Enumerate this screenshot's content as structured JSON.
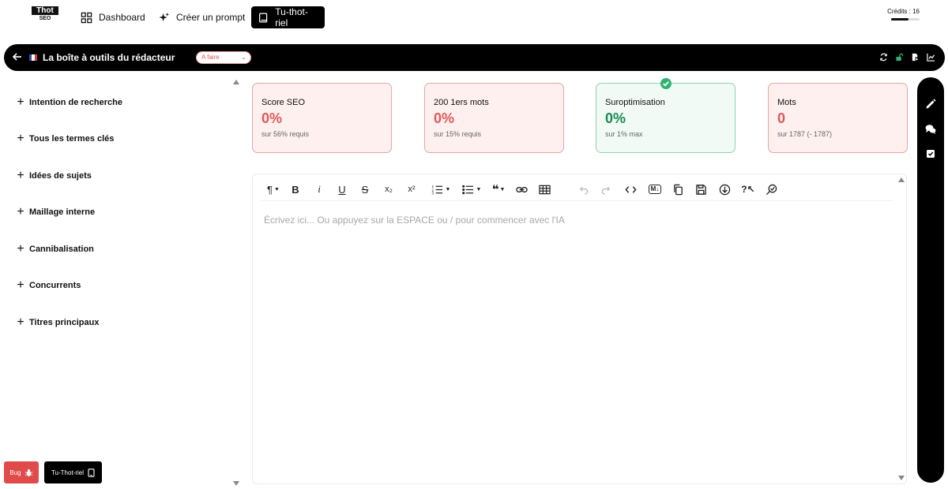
{
  "brand": {
    "line1": "Thot",
    "line2": "SEO"
  },
  "nav": {
    "dashboard": "Dashboard",
    "prompt": "Créer un prompt",
    "tutorial": "Tu-thot-riel"
  },
  "credits": {
    "label": "Crédits : 16",
    "level": 0.6
  },
  "titlebar": {
    "title": "La boîte à outils du rédacteur",
    "status": "A faire"
  },
  "sidebar": {
    "items": [
      {
        "label": "Intention de recherche"
      },
      {
        "label": "Tous les termes clés"
      },
      {
        "label": "Idées de sujets"
      },
      {
        "label": "Maillage interne"
      },
      {
        "label": "Cannibalisation"
      },
      {
        "label": "Concurrents"
      },
      {
        "label": "Titres principaux"
      }
    ],
    "bug_label": "Bug",
    "tutorial_label": "Tu-Thot-riel"
  },
  "cards": [
    {
      "title": "Score SEO",
      "value": "0%",
      "sub": "sur 56% requis",
      "status": "red"
    },
    {
      "title": "200 1ers mots",
      "value": "0%",
      "sub": "sur 15% requis",
      "status": "red"
    },
    {
      "title": "Suroptimisation",
      "value": "0%",
      "sub": "sur 1% max",
      "status": "green"
    },
    {
      "title": "Mots",
      "value": "0",
      "sub": "sur 1787 (- 1787)",
      "status": "red"
    }
  ],
  "editor": {
    "placeholder": "Écrivez ici... Ou appuyez sur la ESPACE ou / pour commencer avec l'IA",
    "md_badge": "M↓"
  },
  "colors": {
    "accent_red": "#e05a5a",
    "accent_green": "#1a8a52",
    "bar_black": "#000000"
  }
}
